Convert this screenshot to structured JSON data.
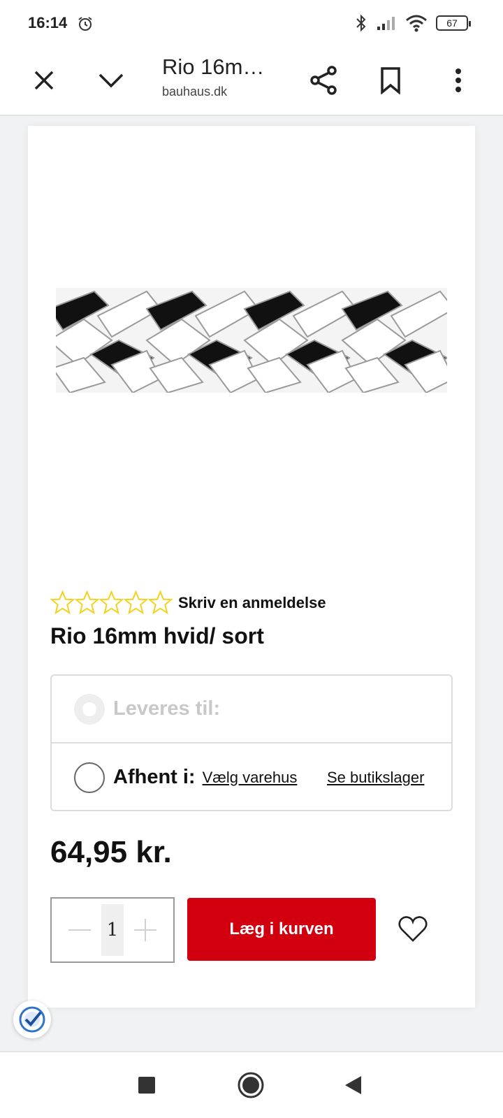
{
  "status_bar": {
    "time": "16:14",
    "battery": "67",
    "icons": [
      "alarm-icon",
      "bluetooth-icon",
      "signal-icon",
      "wifi-icon",
      "battery-icon"
    ]
  },
  "toolbar": {
    "title": "Rio 16m…",
    "domain": "bauhaus.dk",
    "icons": [
      "close-icon",
      "chevron-down-icon",
      "share-icon",
      "bookmark-icon",
      "more-vert-icon"
    ]
  },
  "product": {
    "review_link": "Skriv en anmeldelse",
    "rating": 0,
    "rating_max": 5,
    "name": "Rio 16mm hvid/ sort",
    "price": "64,95 kr.",
    "image_colors": [
      "#ffffff",
      "#111111"
    ]
  },
  "delivery": {
    "deliver_label": "Leveres til:",
    "pickup_label": "Afhent i:",
    "choose_store": "Vælg varehus",
    "store_stock": "Se butikslager"
  },
  "purchase": {
    "quantity": "1",
    "add_to_cart": "Læg i kurven"
  },
  "colors": {
    "accent": "#d2000f",
    "star": "#f2d21b"
  },
  "nav_bar": {
    "icons": [
      "recents-icon",
      "home-icon",
      "back-icon"
    ]
  }
}
